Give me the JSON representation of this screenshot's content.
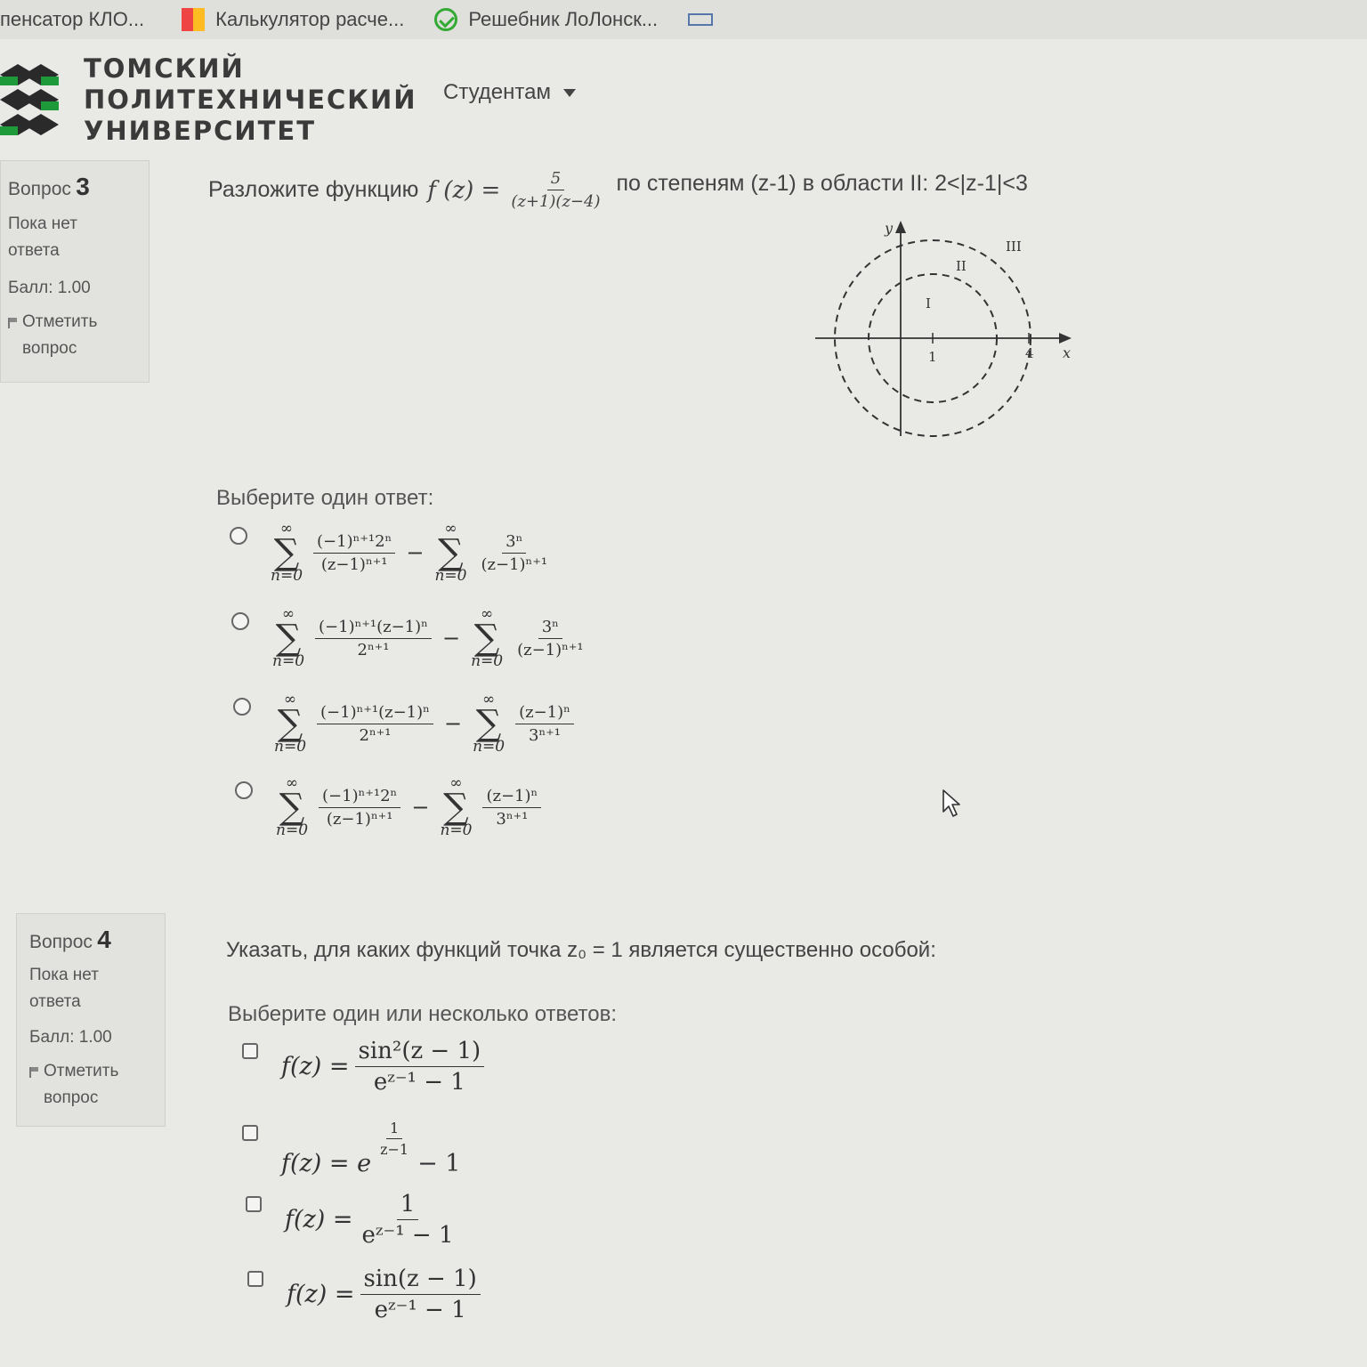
{
  "bookmarks": [
    {
      "label": "пенсатор КЛО...",
      "icon": ""
    },
    {
      "label": "Калькулятор расче...",
      "icon": "calculator-icon"
    },
    {
      "label": "Решебник ЛоЛонск...",
      "icon": "check-icon"
    },
    {
      "label": "",
      "icon": "grid-icon"
    }
  ],
  "header": {
    "logo_line1": "ТОМСКИЙ",
    "logo_line2": "ПОЛИТЕХНИЧЕСКИЙ",
    "logo_line3": "УНИВЕРСИТЕТ",
    "nav_students": "Студентам"
  },
  "q3": {
    "info_label": "Вопрос",
    "number": "3",
    "status": "Пока нет ответа",
    "score": "Балл: 1.00",
    "flag": "Отметить вопрос",
    "text_before": "Разложите функцию",
    "fn_lhs": "f (z) =",
    "fn_num": "5",
    "fn_den": "(z+1)(z−4)",
    "text_after": "по степеням (z-1) в области  II: 2<|z-1|<3",
    "diagram": {
      "y": "y",
      "x": "x",
      "one": "1",
      "four": "4",
      "r1": "I",
      "r2": "II",
      "r3": "III"
    },
    "prompt": "Выберите один ответ:",
    "options": [
      {
        "s1": {
          "top": "∞",
          "bot": "n=0"
        },
        "f1": {
          "num": "(−1)ⁿ⁺¹2ⁿ",
          "den": "(z−1)ⁿ⁺¹"
        },
        "op": "−",
        "s2": {
          "top": "∞",
          "bot": "n=0"
        },
        "f2": {
          "num": "3ⁿ",
          "den": "(z−1)ⁿ⁺¹"
        }
      },
      {
        "s1": {
          "top": "∞",
          "bot": "n=0"
        },
        "f1": {
          "num": "(−1)ⁿ⁺¹(z−1)ⁿ",
          "den": "2ⁿ⁺¹"
        },
        "op": "−",
        "s2": {
          "top": "∞",
          "bot": "n=0"
        },
        "f2": {
          "num": "3ⁿ",
          "den": "(z−1)ⁿ⁺¹"
        }
      },
      {
        "s1": {
          "top": "∞",
          "bot": "n=0"
        },
        "f1": {
          "num": "(−1)ⁿ⁺¹(z−1)ⁿ",
          "den": "2ⁿ⁺¹"
        },
        "op": "−",
        "s2": {
          "top": "∞",
          "bot": "n=0"
        },
        "f2": {
          "num": "(z−1)ⁿ",
          "den": "3ⁿ⁺¹"
        }
      },
      {
        "s1": {
          "top": "∞",
          "bot": "n=0"
        },
        "f1": {
          "num": "(−1)ⁿ⁺¹2ⁿ",
          "den": "(z−1)ⁿ⁺¹"
        },
        "op": "−",
        "s2": {
          "top": "∞",
          "bot": "n=0"
        },
        "f2": {
          "num": "(z−1)ⁿ",
          "den": "3ⁿ⁺¹"
        }
      }
    ]
  },
  "q4": {
    "info_label": "Вопрос",
    "number": "4",
    "status": "Пока нет ответа",
    "score": "Балл: 1.00",
    "flag": "Отметить вопрос",
    "text": "Указать, для каких функций точка z₀ = 1  является существенно особой:",
    "prompt": "Выберите один или несколько ответов:",
    "options": [
      {
        "lhs": "f(z) =",
        "num": "sin²(z − 1)",
        "den": "eᶻ⁻¹ − 1"
      },
      {
        "lhs": "f(z) = e",
        "exp_num": "1",
        "exp_den": "z−1",
        "tail": "− 1"
      },
      {
        "lhs": "f(z) =",
        "num": "1",
        "den": "eᶻ⁻¹ − 1"
      },
      {
        "lhs": "f(z) =",
        "num": "sin(z − 1)",
        "den": "eᶻ⁻¹ − 1"
      }
    ]
  }
}
